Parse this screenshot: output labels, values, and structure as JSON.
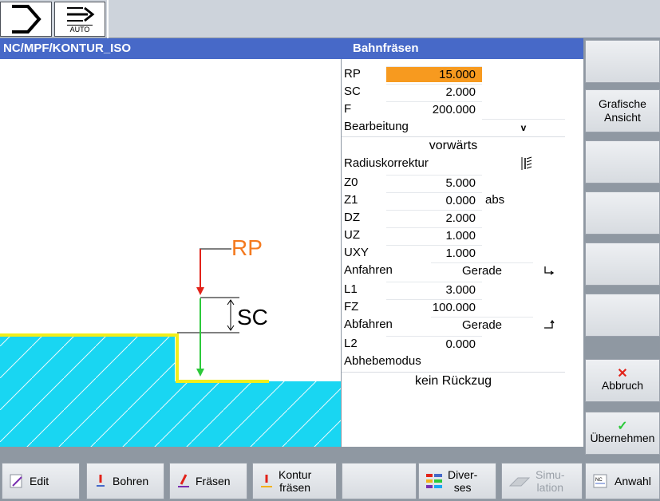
{
  "status": {
    "auto_label": "AUTO"
  },
  "header": {
    "program_path": "NC/MPF/KONTUR_ISO",
    "dialog_title": "Bahnfräsen"
  },
  "graphic": {
    "label_rp": "RP",
    "label_sc": "SC"
  },
  "params": {
    "rp": {
      "label": "RP",
      "value": "15.000"
    },
    "sc": {
      "label": "SC",
      "value": "2.000"
    },
    "f": {
      "label": "F",
      "value": "200.000"
    },
    "bearbeitung": {
      "label": "Bearbeitung",
      "value": "v",
      "mode": "vorwärts"
    },
    "radiuskorrektur": {
      "label": "Radiuskorrektur",
      "icon": "cutter-compensation-icon"
    },
    "z0": {
      "label": "Z0",
      "value": "5.000"
    },
    "z1": {
      "label": "Z1",
      "value": "0.000",
      "unit": "abs"
    },
    "dz": {
      "label": "DZ",
      "value": "2.000"
    },
    "uz": {
      "label": "UZ",
      "value": "1.000"
    },
    "uxy": {
      "label": "UXY",
      "value": "1.000"
    },
    "anfahren": {
      "label": "Anfahren",
      "value": "Gerade",
      "icon": "approach-line-icon"
    },
    "l1": {
      "label": "L1",
      "value": "3.000"
    },
    "fz": {
      "label": "FZ",
      "value": "100.000"
    },
    "abfahren": {
      "label": "Abfahren",
      "value": "Gerade",
      "icon": "retract-line-icon"
    },
    "l2": {
      "label": "L2",
      "value": "0.000"
    },
    "abhebemodus": {
      "label": "Abhebemodus",
      "value": "kein Rückzug"
    }
  },
  "vsoftkeys": {
    "grafische_line1": "Grafische",
    "grafische_line2": "Ansicht",
    "abbruch": "Abbruch",
    "uebernehmen": "Übernehmen"
  },
  "hsoftkeys": {
    "edit": "Edit",
    "bohren": "Bohren",
    "fraesen": "Fräsen",
    "kontur_line1": "Kontur",
    "kontur_line2": "fräsen",
    "diverses_line1": "Diver-",
    "diverses_line2": "ses",
    "simulation_line1": "Simu-",
    "simulation_line2": "lation",
    "anwahl": "Anwahl"
  },
  "colors": {
    "header": "#4769c8",
    "highlight": "#f79a1f",
    "workpiece": "#19d6f2",
    "contour": "#f2ee1a",
    "rp_arrow": "#e2231a",
    "sc_arrow": "#2cc93a",
    "rp_label": "#f47a1f"
  }
}
